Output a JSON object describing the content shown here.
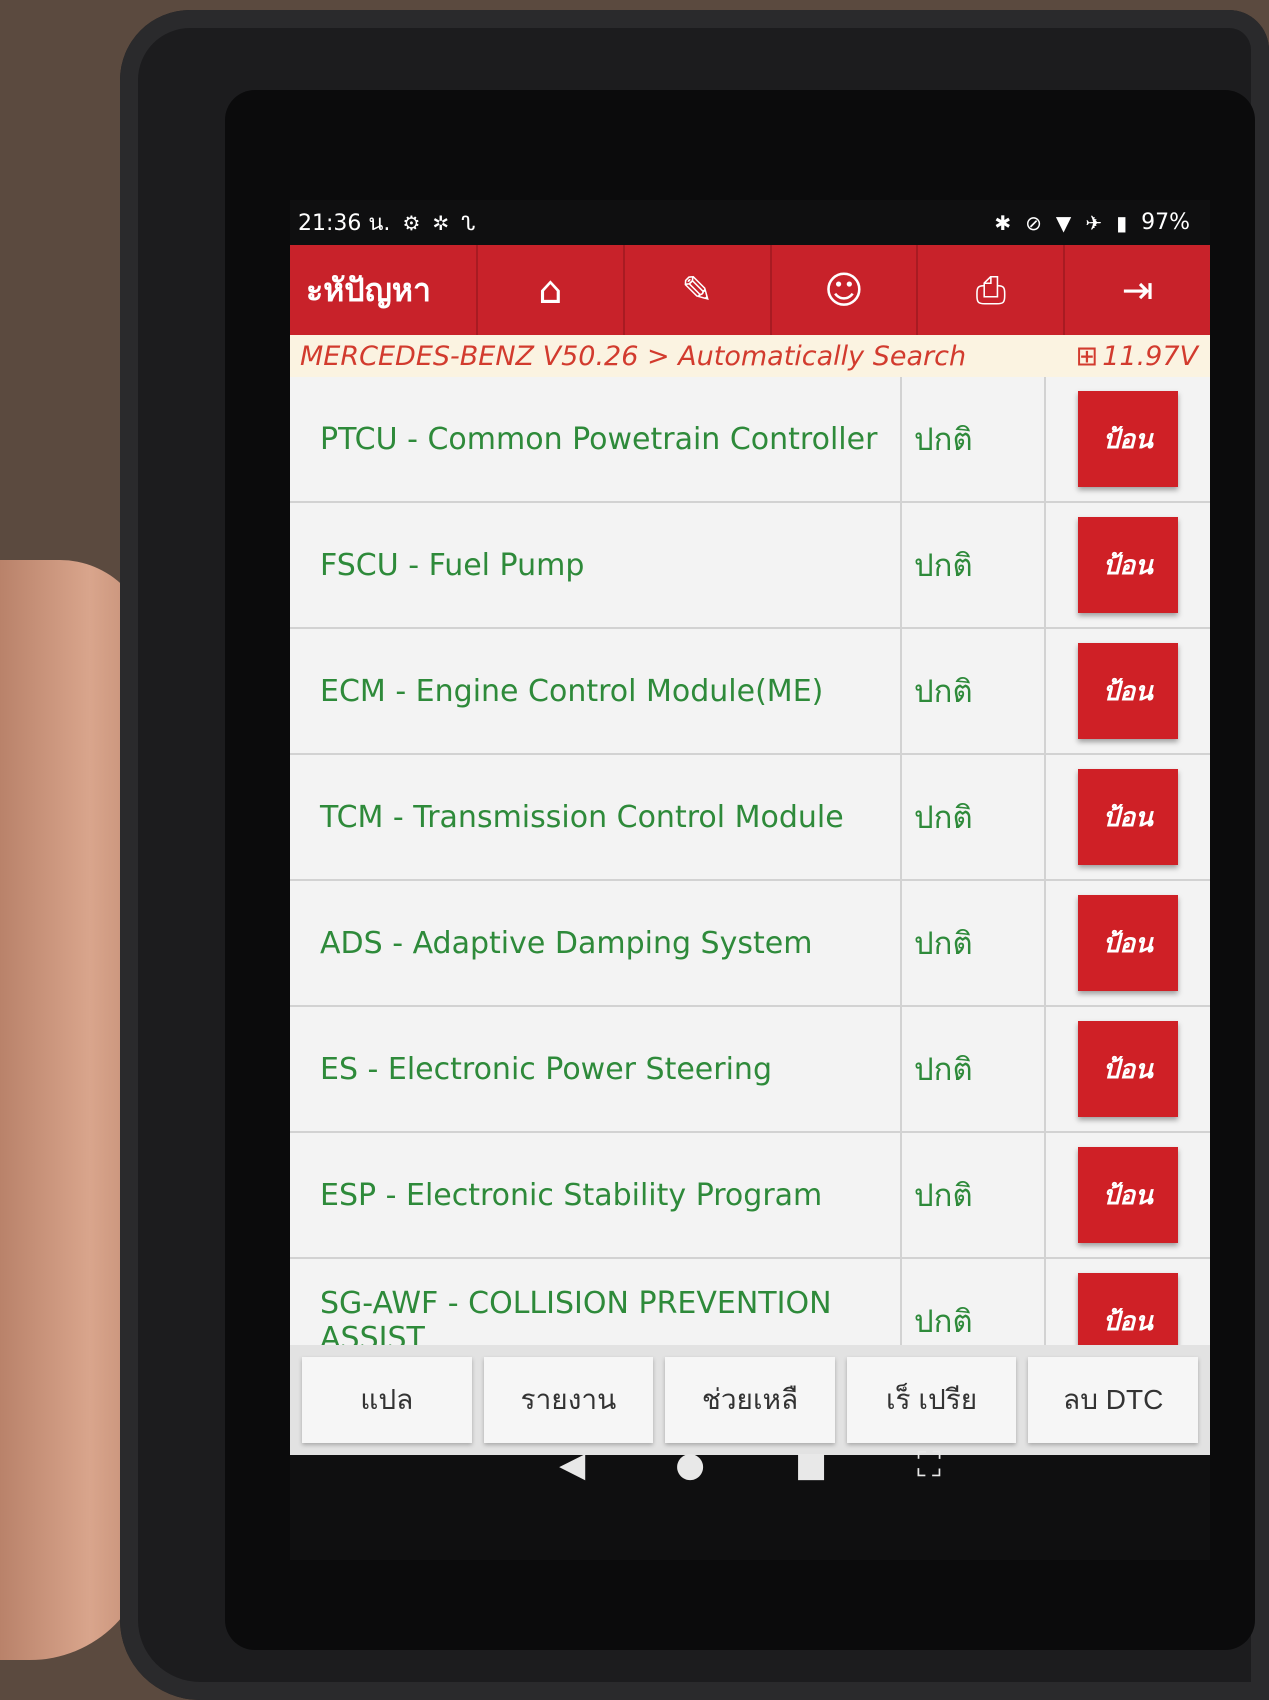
{
  "status_bar": {
    "time": "21:36 น.",
    "battery": "97%",
    "left_icons": [
      "gear-icon",
      "asterisk-icon",
      "stethoscope-icon"
    ],
    "right_icons": [
      "bluetooth-icon",
      "bell-off-icon",
      "wifi-icon",
      "airplane-icon",
      "battery-icon"
    ]
  },
  "toolbar": {
    "title": "ะหัปัญหา",
    "buttons": [
      "home-icon",
      "edit-icon",
      "support-icon",
      "print-icon",
      "exit-icon"
    ]
  },
  "breadcrumb": {
    "path": "MERCEDES-BENZ V50.26 > Automatically Search",
    "voltage": "11.97V"
  },
  "systems": [
    {
      "name": "PTCU - Common Powetrain Controller",
      "status": "ปกติ",
      "action": "ป้อน"
    },
    {
      "name": "FSCU - Fuel Pump",
      "status": "ปกติ",
      "action": "ป้อน"
    },
    {
      "name": "ECM - Engine Control Module(ME)",
      "status": "ปกติ",
      "action": "ป้อน"
    },
    {
      "name": "TCM - Transmission Control Module",
      "status": "ปกติ",
      "action": "ป้อน"
    },
    {
      "name": "ADS - Adaptive Damping System",
      "status": "ปกติ",
      "action": "ป้อน"
    },
    {
      "name": "ES - Electronic Power Steering",
      "status": "ปกติ",
      "action": "ป้อน"
    },
    {
      "name": "ESP - Electronic Stability Program",
      "status": "ปกติ",
      "action": "ป้อน"
    },
    {
      "name": "SG-AWF - COLLISION PREVENTION ASSIST",
      "status": "ปกติ",
      "action": "ป้อน"
    }
  ],
  "bottom_buttons": [
    "แปล",
    "รายงาน",
    "ช่วยเหลื",
    "เร็ เปรีย",
    "ลบ DTC"
  ],
  "colors": {
    "accent": "#c8222a",
    "text_green": "#2e8a3a",
    "breadcrumb_text": "#d23b2e"
  }
}
